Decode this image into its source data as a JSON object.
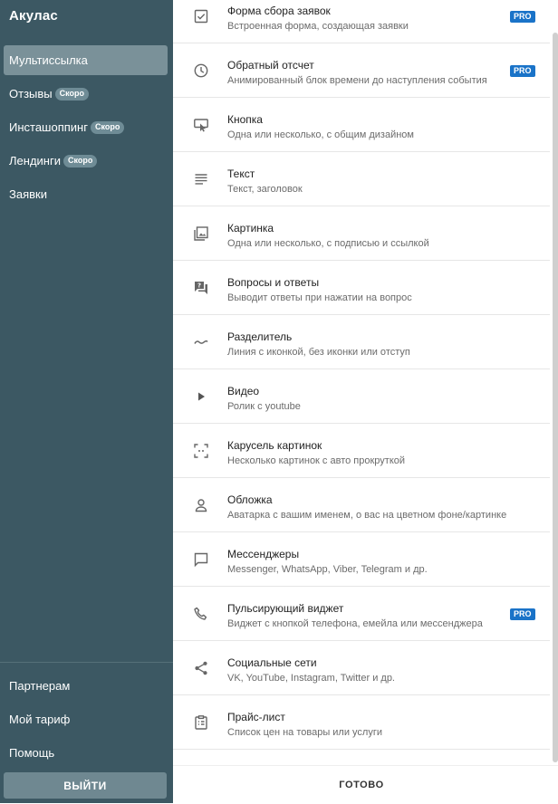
{
  "sidebar": {
    "brand": "Акулас",
    "items": [
      {
        "label": "Мультиссылка",
        "badge": null,
        "active": true
      },
      {
        "label": "Отзывы",
        "badge": "Скоро",
        "active": false
      },
      {
        "label": "Инсташоппинг",
        "badge": "Скоро",
        "active": false
      },
      {
        "label": "Лендинги",
        "badge": "Скоро",
        "active": false
      },
      {
        "label": "Заявки",
        "badge": null,
        "active": false
      }
    ],
    "bottom_items": [
      {
        "label": "Партнерам"
      },
      {
        "label": "Мой тариф"
      },
      {
        "label": "Помощь"
      }
    ],
    "logout_label": "ВЫЙТИ"
  },
  "blocks": [
    {
      "icon": "checkbox-icon",
      "title": "Форма сбора заявок",
      "desc": "Встроенная форма, создающая заявки",
      "pro": "PRO"
    },
    {
      "icon": "clock-icon",
      "title": "Обратный отсчет",
      "desc": "Анимированный блок времени до наступления события",
      "pro": "PRO"
    },
    {
      "icon": "button-icon",
      "title": "Кнопка",
      "desc": "Одна или несколько, с общим дизайном",
      "pro": null
    },
    {
      "icon": "text-icon",
      "title": "Текст",
      "desc": "Текст, заголовок",
      "pro": null
    },
    {
      "icon": "image-icon",
      "title": "Картинка",
      "desc": "Одна или несколько, с подписью и ссылкой",
      "pro": null
    },
    {
      "icon": "question-answer-icon",
      "title": "Вопросы и ответы",
      "desc": "Выводит ответы при нажатии на вопрос",
      "pro": null
    },
    {
      "icon": "tilde-divider-icon",
      "title": "Разделитель",
      "desc": "Линия с иконкой, без иконки или отступ",
      "pro": null
    },
    {
      "icon": "play-icon",
      "title": "Видео",
      "desc": "Ролик с youtube",
      "pro": null
    },
    {
      "icon": "carousel-icon",
      "title": "Карусель картинок",
      "desc": "Несколько картинок с авто прокруткой",
      "pro": null
    },
    {
      "icon": "person-icon",
      "title": "Обложка",
      "desc": "Аватарка с вашим именем, о вас на цветном фоне/картинке",
      "pro": null
    },
    {
      "icon": "chat-bubble-icon",
      "title": "Мессенджеры",
      "desc": "Messenger, WhatsApp, Viber, Telegram и др.",
      "pro": null
    },
    {
      "icon": "phone-icon",
      "title": "Пульсирующий виджет",
      "desc": "Виджет с кнопкой телефона, емейла или мессенджера",
      "pro": "PRO"
    },
    {
      "icon": "share-icon",
      "title": "Социальные сети",
      "desc": "VK, YouTube, Instagram, Twitter и др.",
      "pro": null
    },
    {
      "icon": "clipboard-list-icon",
      "title": "Прайс-лист",
      "desc": "Список цен на товары или услуги",
      "pro": null
    }
  ],
  "footer": {
    "done_label": "ГОТОВО"
  },
  "colors": {
    "sidebar": "#3c5863",
    "active_item": "#7a9199",
    "pro_badge": "#1a73c8"
  }
}
